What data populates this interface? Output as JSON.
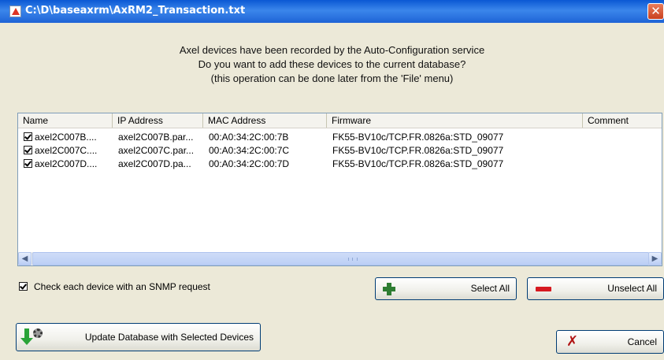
{
  "window": {
    "title": "C:\\D\\baseaxrm\\AxRM2_Transaction.txt",
    "close_label": "✕"
  },
  "message": {
    "line1": "Axel devices have been recorded by the Auto-Configuration service",
    "line2": "Do you want to add these devices to the current database?",
    "line3": "(this operation can be done later from the 'File' menu)"
  },
  "table": {
    "columns": [
      "Name",
      "IP Address",
      "MAC Address",
      "Firmware",
      "Comment"
    ],
    "rows": [
      {
        "checked": true,
        "name": "axel2C007B....",
        "ip": "axel2C007B.par...",
        "mac": "00:A0:34:2C:00:7B",
        "firmware": "FK55-BV10c/TCP.FR.0826a:STD_09077",
        "comment": ""
      },
      {
        "checked": true,
        "name": "axel2C007C....",
        "ip": "axel2C007C.par...",
        "mac": "00:A0:34:2C:00:7C",
        "firmware": "FK55-BV10c/TCP.FR.0826a:STD_09077",
        "comment": ""
      },
      {
        "checked": true,
        "name": "axel2C007D....",
        "ip": "axel2C007D.pa...",
        "mac": "00:A0:34:2C:00:7D",
        "firmware": "FK55-BV10c/TCP.FR.0826a:STD_09077",
        "comment": ""
      }
    ]
  },
  "snmp": {
    "label": "Check each device with an SNMP request",
    "checked": true
  },
  "buttons": {
    "select_all": "Select All",
    "unselect_all": "Unselect All",
    "update": "Update Database with Selected Devices",
    "cancel": "Cancel"
  },
  "icons": {
    "window": "app-icon",
    "select_all": "plus-icon",
    "unselect_all": "minus-icon",
    "update": "database-import-icon",
    "cancel": "x-icon"
  }
}
